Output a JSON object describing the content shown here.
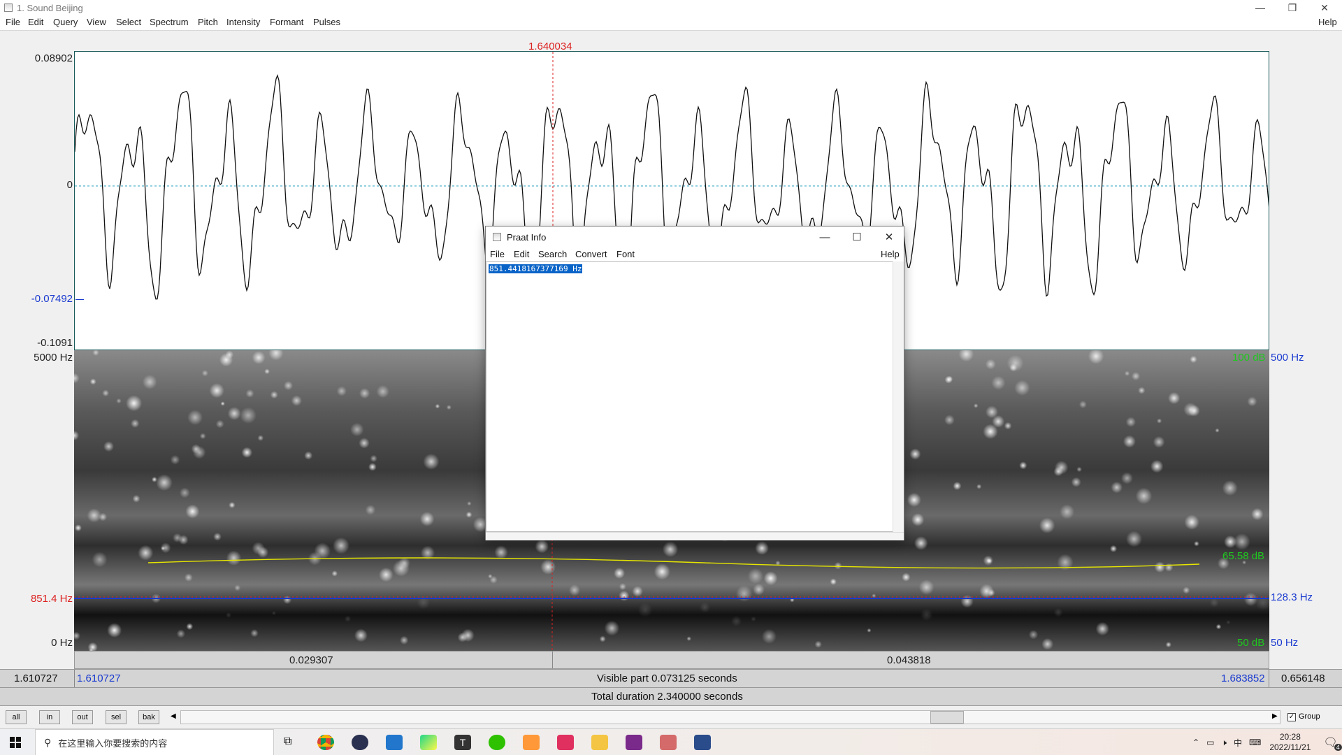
{
  "window": {
    "title": "1. Sound Beijing",
    "minimize": "—",
    "restore": "❐",
    "close": "✕"
  },
  "menu": [
    "File",
    "Edit",
    "Query",
    "View",
    "Select",
    "Spectrum",
    "Pitch",
    "Intensity",
    "Formant",
    "Pulses"
  ],
  "menu_help": "Help",
  "cursor_time": "1.640034",
  "waveform": {
    "ymax": "0.08902",
    "yzero": "0",
    "ycursor": "-0.07492",
    "ymin": "-0.1091"
  },
  "spectrogram": {
    "freq_top": "5000 Hz",
    "freq_cursor": "851.4 Hz",
    "freq_bottom": "0 Hz",
    "right_top_db": "100 dB",
    "right_top_hz": "500 Hz",
    "right_mid_db": "65.58 dB",
    "right_cursor_hz": "128.3 Hz",
    "right_bottom_db": "50 dB",
    "right_bottom_hz": "50 Hz"
  },
  "axis": {
    "left_segment": "0.029307",
    "right_segment": "0.043818"
  },
  "info": {
    "window_start": "1.610727",
    "visible_start": "1.610727",
    "visible_label": "Visible part 0.073125 seconds",
    "visible_end": "1.683852",
    "window_end": "0.656148",
    "total": "Total duration 2.340000 seconds"
  },
  "buttons": [
    "all",
    "in",
    "out",
    "sel",
    "bak"
  ],
  "group_label": "Group",
  "group_checked": true,
  "dialog": {
    "title": "Praat Info",
    "menu": [
      "File",
      "Edit",
      "Search",
      "Convert",
      "Font"
    ],
    "help": "Help",
    "content": "851.4418167377169 Hz"
  },
  "taskbar": {
    "search_placeholder": "在这里输入你要搜索的内容",
    "ime": "中",
    "time": "20:28",
    "date": "2022/11/21",
    "notif_count": "4"
  }
}
